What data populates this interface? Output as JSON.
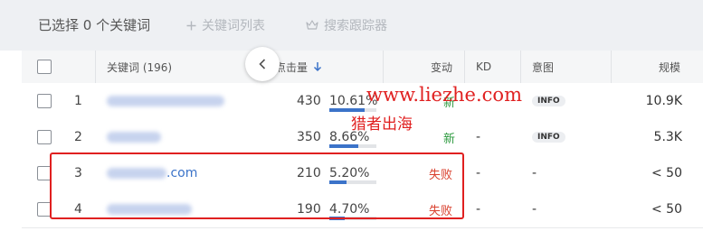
{
  "toolbar": {
    "selected_label": "已选择 0 个关键词",
    "keyword_list_label": "关键词列表",
    "tracker_label": "搜索跟踪器"
  },
  "table": {
    "columns": {
      "keyword": "关键词 (196)",
      "clicks": "点击量",
      "change": "变动",
      "kd": "KD",
      "intent": "意图",
      "volume": "规模"
    },
    "rows": [
      {
        "rank": "1",
        "keyword_suffix": "",
        "clicks": "430",
        "share": "10.61%",
        "share_value": 0.1061,
        "change": "新",
        "change_type": "new",
        "kd": "",
        "intent": "INFO",
        "volume": "10.9K"
      },
      {
        "rank": "2",
        "keyword_suffix": "",
        "clicks": "350",
        "share": "8.66%",
        "share_value": 0.0866,
        "change": "新",
        "change_type": "new",
        "kd": "-",
        "intent": "INFO",
        "volume": "5.3K"
      },
      {
        "rank": "3",
        "keyword_suffix": ".com",
        "clicks": "210",
        "share": "5.20%",
        "share_value": 0.052,
        "change": "失败",
        "change_type": "fail",
        "kd": "-",
        "intent": "-",
        "volume": "< 50"
      },
      {
        "rank": "4",
        "keyword_suffix": "",
        "clicks": "190",
        "share": "4.70%",
        "share_value": 0.047,
        "change": "失败",
        "change_type": "fail",
        "kd": "-",
        "intent": "-",
        "volume": "< 50"
      }
    ]
  },
  "watermark": {
    "url": "www.liezhe.com",
    "text": "猎者出海"
  },
  "colors": {
    "accent": "#3b73c9",
    "new": "#2d9a3f",
    "fail": "#d9412f",
    "highlight": "#e02020"
  },
  "icons": {
    "add": "plus-icon",
    "tracker": "crown-icon",
    "sort": "arrow-down-icon",
    "collapse": "chevron-left-icon"
  }
}
